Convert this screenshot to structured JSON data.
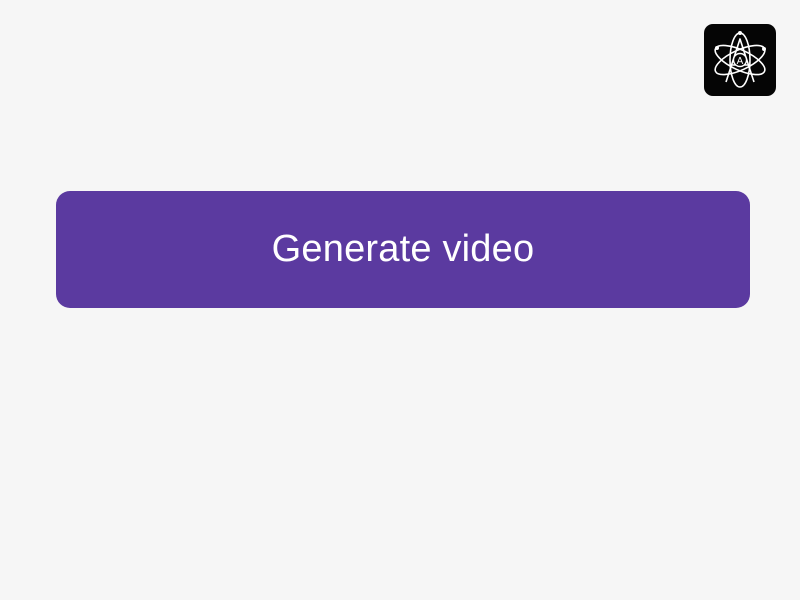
{
  "app": {
    "background_color": "#f6f6f6",
    "logo": {
      "icon": "atom-a-logo-icon",
      "letter": "A",
      "background_color": "#050505",
      "foreground_color": "#ffffff"
    }
  },
  "main": {
    "generate_button": {
      "label": "Generate video",
      "color": "#5b3aa0",
      "text_color": "#ffffff"
    }
  }
}
